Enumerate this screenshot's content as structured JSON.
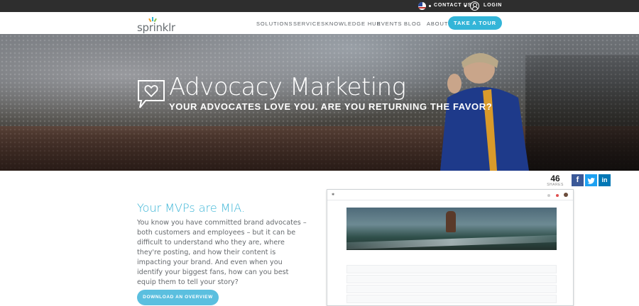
{
  "topbar": {
    "contact_label": "CONTACT US",
    "login_label": "LOGIN"
  },
  "nav": {
    "logo_text": "sprinklr",
    "items": [
      "SOLUTIONS",
      "SERVICES",
      "KNOWLEDGE HUB",
      "EVENTS",
      "BLOG",
      "ABOUT"
    ],
    "cta_label": "TAKE A TOUR"
  },
  "hero": {
    "title": "Advocacy Marketing",
    "subtitle": "YOUR ADVOCATES LOVE YOU. ARE YOU RETURNING THE FAVOR?"
  },
  "share": {
    "count": "46",
    "label": "SHARES",
    "facebook_glyph": "f",
    "linkedin_glyph": "in",
    "colors": {
      "facebook": "#3b5998",
      "twitter": "#1da1f2",
      "linkedin": "#0077b5"
    }
  },
  "content": {
    "heading": "Your MVPs are MIA.",
    "body": "You know you have committed brand advocates – both customers and employees – but it can be difficult to understand who they are, where they're posting, and how their content is impacting your brand. And even when you identify your biggest fans, how can you best equip them to tell your story?",
    "download_label": "DOWNLOAD AN OVERVIEW"
  },
  "colors": {
    "accent": "#33b5d8",
    "topbar": "#2e2e2e",
    "text": "#666a6e"
  }
}
